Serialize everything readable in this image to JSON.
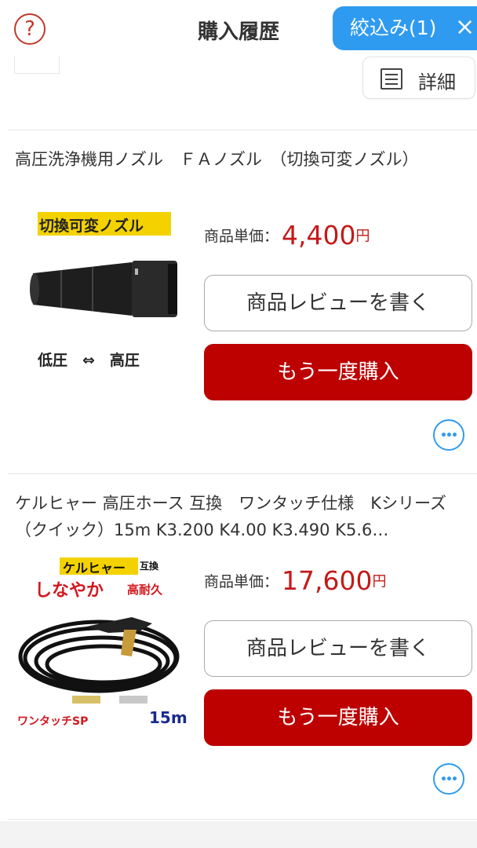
{
  "header": {
    "help_icon": "?",
    "title": "購入履歴",
    "filter_label": "絞込み(1)",
    "filter_close": "×"
  },
  "prev_card": {
    "detail_label": "詳細"
  },
  "items": [
    {
      "title": "高圧洗浄機用ノズル　ＦＡノズル　（切換可変ノズル）",
      "image_caption_top": "切換可変ノズル",
      "image_caption_bottom": "低圧　⇔　高圧",
      "price_label": "商品単価：",
      "price": "4,400",
      "currency": "円",
      "review_label": "商品レビューを書く",
      "rebuy_label": "もう一度購入",
      "more_icon": "more-horizontal-icon"
    },
    {
      "title": "ケルヒャー 高圧ホース 互換　ワンタッチ仕様　Kシリーズ（クイック）15m K3.200 K4.00 K3.490 K5.6…",
      "image_caption_brand": "ケルヒャー",
      "image_caption_compat": "互換",
      "image_caption_flex": "しなやか",
      "image_caption_durable": "高耐久",
      "image_caption_sp": "ワンタッチSP",
      "image_caption_length": "15m",
      "price_label": "商品単価：",
      "price": "17,600",
      "currency": "円",
      "review_label": "商品レビューを書く",
      "rebuy_label": "もう一度購入",
      "more_icon": "more-horizontal-icon"
    }
  ],
  "colors": {
    "accent_blue": "#2f9bf0",
    "buy_red": "#bd0000",
    "price_red": "#c41a1a",
    "help_red": "#c0392b"
  }
}
